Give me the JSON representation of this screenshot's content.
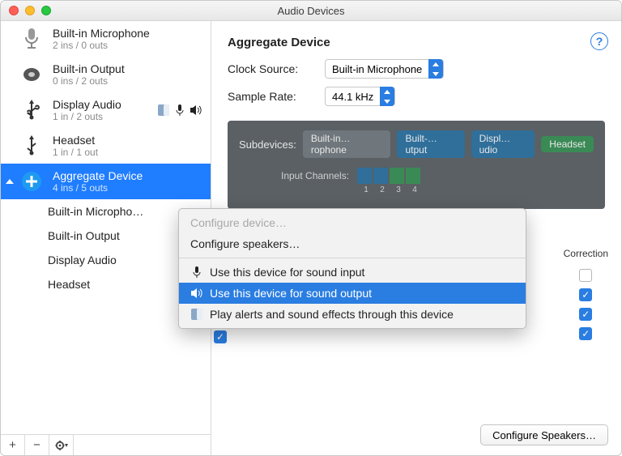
{
  "window": {
    "title": "Audio Devices"
  },
  "sidebar": {
    "devices": [
      {
        "name": "Built-in Microphone",
        "io": "2 ins / 0 outs"
      },
      {
        "name": "Built-in Output",
        "io": "0 ins / 2 outs"
      },
      {
        "name": "Display Audio",
        "io": "1 in / 2 outs",
        "status_icons": true
      },
      {
        "name": "Headset",
        "io": "1 in / 1 out"
      },
      {
        "name": "Aggregate Device",
        "io": "4 ins / 5 outs",
        "selected": true
      }
    ],
    "children": [
      "Built-in Micropho…",
      "Built-in Output",
      "Display Audio",
      "Headset"
    ],
    "plus": "+",
    "minus": "−"
  },
  "main": {
    "title": "Aggregate Device",
    "clock_label": "Clock Source:",
    "clock_value": "Built-in Microphone",
    "rate_label": "Sample Rate:",
    "rate_value": "44.1 kHz",
    "help": "?"
  },
  "subpanel": {
    "label": "Subdevices:",
    "pills": [
      "Built-in…rophone",
      "Built-…utput",
      "Displ…udio",
      "Headset"
    ],
    "input_label": "Input Channels:",
    "numbers": [
      "1",
      "2",
      "3",
      "4"
    ]
  },
  "menu": {
    "items": [
      {
        "label": "Configure device…",
        "disabled": true
      },
      {
        "label": "Configure speakers…"
      },
      {
        "sep": true
      },
      {
        "label": "Use this device for sound input",
        "icon": "mic"
      },
      {
        "label": "Use this device for sound output",
        "icon": "speaker",
        "selected": true
      },
      {
        "label": "Play alerts and sound effects through this device",
        "icon": "finder"
      }
    ]
  },
  "rightcol": {
    "header": "Correction",
    "checks": [
      false,
      true,
      true,
      true
    ]
  },
  "footer": {
    "button": "Configure Speakers…"
  }
}
